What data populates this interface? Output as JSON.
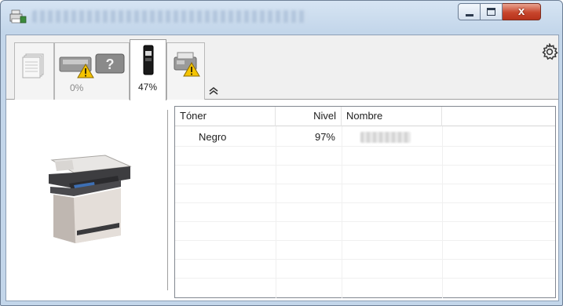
{
  "window": {
    "title_obscured": true,
    "controls": {
      "minimize": "minimize",
      "maximize": "maximize",
      "close": "x"
    }
  },
  "toolbar": {
    "tabs": [
      {
        "name": "paper-status",
        "label": "",
        "selected": false
      },
      {
        "name": "device-warning",
        "label": "0%",
        "selected": false
      },
      {
        "name": "toner",
        "label": "47%",
        "selected": true
      },
      {
        "name": "scanner-warning",
        "label": "",
        "selected": false
      }
    ]
  },
  "table": {
    "columns": [
      "Tóner",
      "Nivel",
      "Nombre"
    ],
    "rows": [
      {
        "toner": "Negro",
        "nivel": "97%",
        "nombre_obscured": true
      }
    ]
  },
  "icons": {
    "app": "printer-app-icon",
    "settings": "gear-icon",
    "collapse": "chevron-up-double-icon",
    "warning": "warning-triangle-icon"
  },
  "colors": {
    "title_gradient_top": "#d6e4f3",
    "close_button": "#c7462d",
    "warning_yellow": "#f5c400",
    "grid_border": "#828790"
  }
}
